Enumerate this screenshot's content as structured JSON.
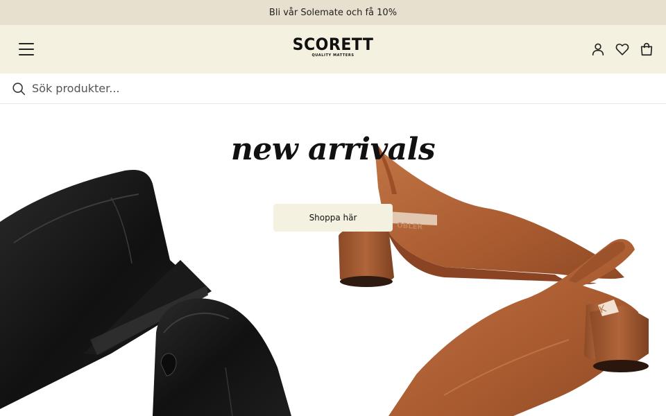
{
  "promo": {
    "text": "Bli vår Solemate och få 10%"
  },
  "header": {
    "logo_text": "SCORETT",
    "logo_tagline": "QUALITY MATTERS",
    "icons": [
      "menu-icon",
      "user-icon",
      "heart-icon",
      "bag-icon"
    ]
  },
  "search": {
    "placeholder": "Sök produkter..."
  },
  "hero": {
    "title": "new arrivals",
    "cta_label": "Shoppa här",
    "shoe_label_1": "OBLER",
    "shoe_label_2": "K"
  },
  "colors": {
    "promo_bg": "#e8e0cf",
    "header_bg": "#f4f1e0",
    "cta_bg": "#f4f1e0",
    "leather_black": "#151515",
    "leather_tan": "#b5653a"
  }
}
